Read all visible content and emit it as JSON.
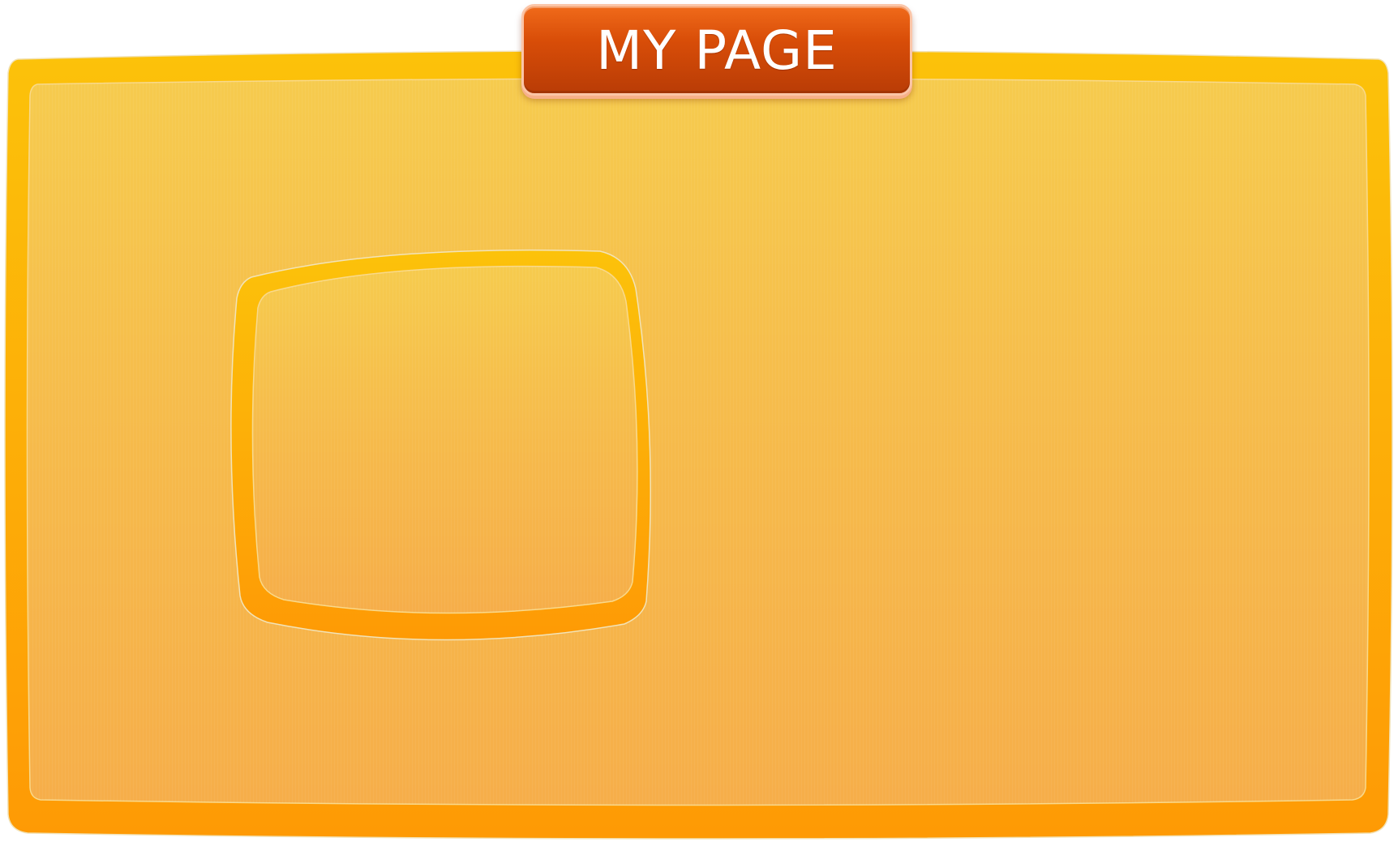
{
  "page": {
    "title": "MY PAGE"
  },
  "colors": {
    "frame_outer_top": "#fcc20a",
    "frame_outer_bottom": "#fe9a05",
    "frame_inner_top": "#f6cb4e",
    "frame_inner_bottom": "#f6ae4a",
    "title_tab_top": "#f06a1a",
    "title_tab_bottom": "#b93c06",
    "title_tab_border": "#fbc5a7",
    "title_text": "#ffffff"
  }
}
